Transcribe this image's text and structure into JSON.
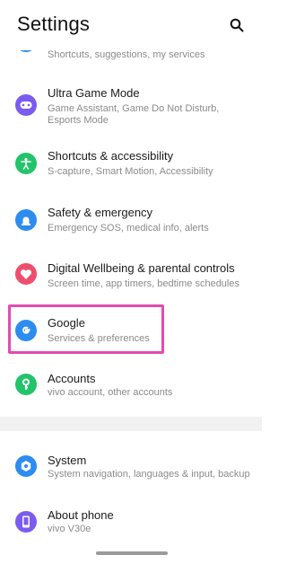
{
  "header": {
    "title": "Settings",
    "search_icon": "search-icon"
  },
  "partial_item": {
    "subtitle": "Shortcuts, suggestions, my services"
  },
  "items": [
    {
      "id": "ultra-game-mode",
      "label": "Ultra Game Mode",
      "subtitle": "Game Assistant, Game Do Not Disturb,",
      "subtitle2": "Esports Mode",
      "icon": "gamepad-icon",
      "color": "#7b5cf0"
    },
    {
      "id": "shortcuts-accessibility",
      "label": "Shortcuts & accessibility",
      "subtitle": "S-capture, Smart Motion, Accessibility",
      "icon": "accessibility-icon",
      "color": "#22c46b"
    },
    {
      "id": "safety-emergency",
      "label": "Safety & emergency",
      "subtitle": "Emergency SOS, medical info, alerts",
      "icon": "siren-icon",
      "color": "#2d8cf0"
    },
    {
      "id": "digital-wellbeing",
      "label": "Digital Wellbeing & parental controls",
      "subtitle": "Screen time, app timers, bedtime schedules",
      "icon": "heart-icon",
      "color": "#ef4f6e"
    },
    {
      "id": "google",
      "label": "Google",
      "subtitle": "Services & preferences",
      "icon": "google-icon",
      "color": "#2d8cf0"
    },
    {
      "id": "accounts",
      "label": "Accounts",
      "subtitle": "vivo account, other accounts",
      "icon": "key-icon",
      "color": "#22c46b"
    },
    {
      "id": "system",
      "label": "System",
      "subtitle": "System navigation, languages & input, backup",
      "icon": "system-gear-icon",
      "color": "#2d8cf0"
    },
    {
      "id": "about-phone",
      "label": "About phone",
      "subtitle": "vivo V30e",
      "icon": "phone-icon",
      "color": "#7b5cf0"
    }
  ],
  "colors": {
    "highlight": "#e34bb0",
    "subtitle": "#8a8a8a",
    "band": "#f1f1f1"
  }
}
